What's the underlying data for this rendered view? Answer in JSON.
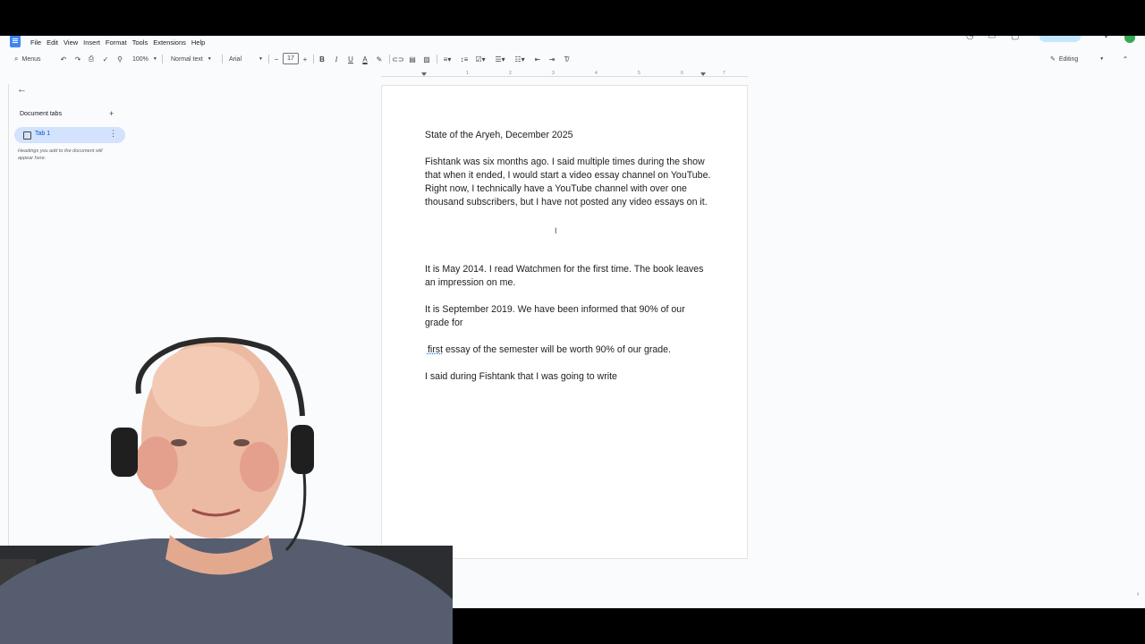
{
  "menu": [
    "File",
    "Edit",
    "View",
    "Insert",
    "Format",
    "Tools",
    "Extensions",
    "Help"
  ],
  "toolbar": {
    "menus_label": "Menus",
    "zoom": "100%",
    "style": "Normal text",
    "font": "Arial",
    "font_size": "17",
    "mode": "Editing"
  },
  "ruler": [
    "1",
    "2",
    "3",
    "4",
    "5",
    "6",
    "7"
  ],
  "sidebar": {
    "title": "Document tabs",
    "tab_label": "Tab 1",
    "hint": "Headings you add to the document will appear here."
  },
  "doc": {
    "title": "State of the Aryeh, December 2025",
    "p1": "Fishtank was six months ago. I said multiple times during the show that when it ended, I would start a video essay channel on YouTube. Right now, I technically have a YouTube channel with over one thousand subscribers, but I have not posted any video essays on it.",
    "p2": "It is May 2014. I read Watchmen for the first time. The book leaves an impression on me.",
    "p3": "It is September 2019. We have been informed that 90% of our grade for",
    "p4_word": "first",
    "p4_rest": " essay of the semester will be worth 90% of our grade.",
    "p5": "I said during Fishtank that I was going to write"
  },
  "icons": {
    "undo": "undo-icon",
    "redo": "redo-icon",
    "print": "print-icon",
    "spellcheck": "spellcheck-icon",
    "paint": "paint-format-icon",
    "bold": "bold-icon",
    "italic": "italic-icon",
    "underline": "underline-icon",
    "link": "link-icon",
    "comment": "comment-icon",
    "image": "image-icon"
  },
  "colors": {
    "accent": "#0b57d0",
    "tab_bg": "#d3e3fd",
    "app_bg": "#f9fbfd"
  }
}
